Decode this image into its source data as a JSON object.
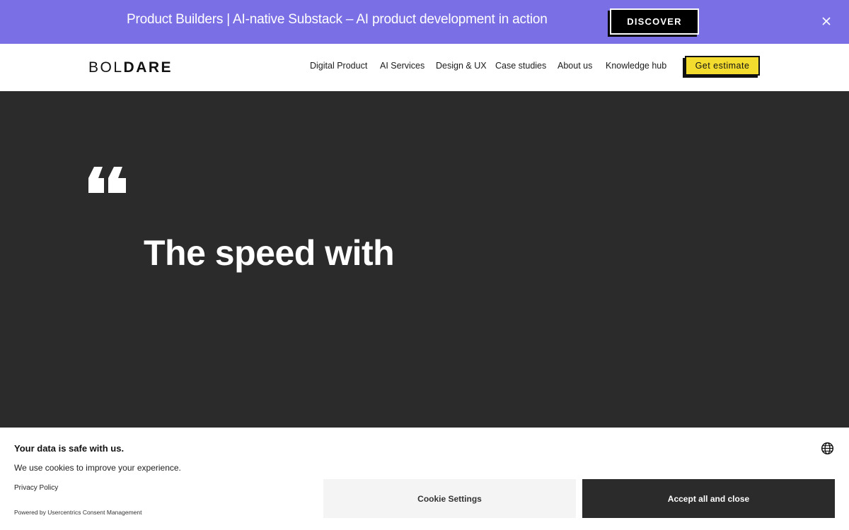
{
  "announcement": {
    "text": "Product Builders | AI-native Substack – AI product development in action",
    "button_label": "DISCOVER",
    "close_icon": "close-icon"
  },
  "header": {
    "logo_light": "BOL",
    "logo_bold": "DARE",
    "nav": [
      {
        "label": "Digital Product"
      },
      {
        "label": "AI Services"
      },
      {
        "label": "Design & UX"
      },
      {
        "label": "Case studies"
      },
      {
        "label": "About us"
      },
      {
        "label": "Knowledge hub"
      }
    ],
    "cta_label": "Get estimate"
  },
  "hero": {
    "quote_icon": "quote-icon",
    "headline": "The speed with"
  },
  "cookie_banner": {
    "title": "Your data is safe with us.",
    "description": "We use cookies to improve your experience.",
    "privacy_link": "Privacy Policy",
    "powered_by": "Powered by Usercentrics Consent Management",
    "settings_button": "Cookie Settings",
    "accept_button": "Accept all and close",
    "language_icon": "globe-icon"
  },
  "colors": {
    "announcement_bg": "#7b6fe6",
    "cta_yellow": "#f4dc2f",
    "hero_bg": "#2b2b2b"
  }
}
